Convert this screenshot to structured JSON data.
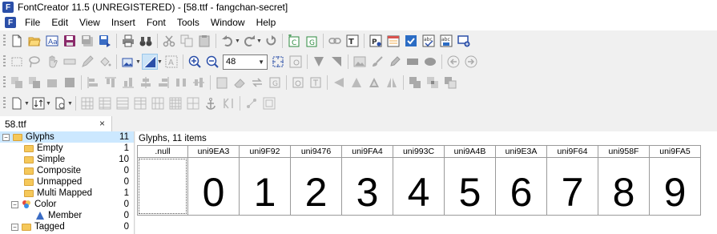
{
  "window": {
    "title": "FontCreator 11.5 (UNREGISTERED) - [58.ttf - fangchan-secret]",
    "app_icon_letter": "F"
  },
  "menu": [
    "File",
    "Edit",
    "View",
    "Insert",
    "Font",
    "Tools",
    "Window",
    "Help"
  ],
  "toolbar": {
    "zoom_value": "48"
  },
  "doc_tab": {
    "label": "58.ttf",
    "close": "×"
  },
  "tree": {
    "items": [
      {
        "label": "Glyphs",
        "count": "11"
      },
      {
        "label": "Empty",
        "count": "1"
      },
      {
        "label": "Simple",
        "count": "10"
      },
      {
        "label": "Composite",
        "count": "0"
      },
      {
        "label": "Unmapped",
        "count": "0"
      },
      {
        "label": "Multi Mapped",
        "count": "1"
      },
      {
        "label": "Color",
        "count": "0"
      },
      {
        "label": "Member",
        "count": "0"
      },
      {
        "label": "Tagged",
        "count": "0"
      }
    ]
  },
  "glyph_panel": {
    "header": "Glyphs, 11 items",
    "glyphs": [
      {
        "name": ".null",
        "char": ""
      },
      {
        "name": "uni9EA3",
        "char": "0"
      },
      {
        "name": "uni9F92",
        "char": "1"
      },
      {
        "name": "uni9476",
        "char": "2"
      },
      {
        "name": "uni9FA4",
        "char": "3"
      },
      {
        "name": "uni993C",
        "char": "4"
      },
      {
        "name": "uni9A4B",
        "char": "5"
      },
      {
        "name": "uni9E3A",
        "char": "6"
      },
      {
        "name": "uni9F64",
        "char": "7"
      },
      {
        "name": "uni958F",
        "char": "8"
      },
      {
        "name": "uni9FA5",
        "char": "9"
      }
    ]
  }
}
